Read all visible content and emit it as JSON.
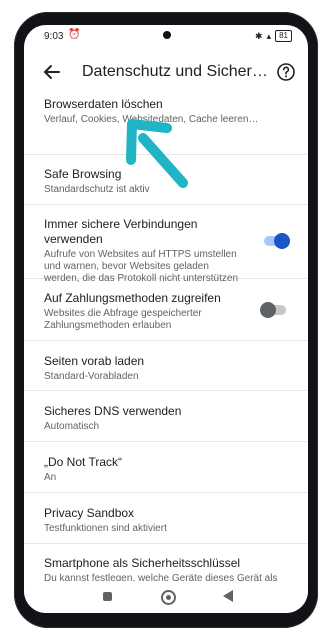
{
  "status_bar": {
    "time": "9:03",
    "battery": "81",
    "icons": [
      "alarm-icon",
      "bluetooth-icon",
      "signal-icon",
      "battery-icon"
    ]
  },
  "app_bar": {
    "title": "Datenschutz und Sicherheit",
    "back_icon": "arrow-left-icon",
    "help_icon": "help-circle-icon"
  },
  "settings": [
    {
      "title": "Browserdaten löschen",
      "subtitle": "Verlauf, Cookies, Websitedaten, Cache leeren…"
    },
    {
      "title": "Safe Browsing",
      "subtitle": "Standardschutz ist aktiv"
    },
    {
      "title": "Immer sichere Verbindungen verwenden",
      "subtitle": "Aufrufe von Websites auf HTTPS umstellen und warnen, bevor Websites geladen werden, die das Protokoll nicht unterstützen",
      "toggle": true
    },
    {
      "title": "Auf Zahlungsmethoden zugreifen",
      "subtitle": "Websites die Abfrage gespeicherter Zahlungsmethoden erlauben",
      "toggle": false
    },
    {
      "title": "Seiten vorab laden",
      "subtitle": "Standard-Vorabladen"
    },
    {
      "title": "Sicheres DNS verwenden",
      "subtitle": "Automatisch"
    },
    {
      "title": "„Do Not Track“",
      "subtitle": "An"
    },
    {
      "title": "Privacy Sandbox",
      "subtitle": "Testfunktionen sind aktiviert"
    },
    {
      "title": "Smartphone als Sicherheitsschlüssel",
      "subtitle": "Du kannst festlegen, welche Geräte dieses Gerät als Sicherheitsschlüssel für die Anmeldung verwenden können"
    }
  ],
  "colors": {
    "accent": "#1a56c8",
    "annotation_arrow": "#1fb5c4"
  },
  "nav_bar": {
    "icons": [
      "recent-apps-icon",
      "home-icon",
      "back-triangle-icon"
    ]
  }
}
